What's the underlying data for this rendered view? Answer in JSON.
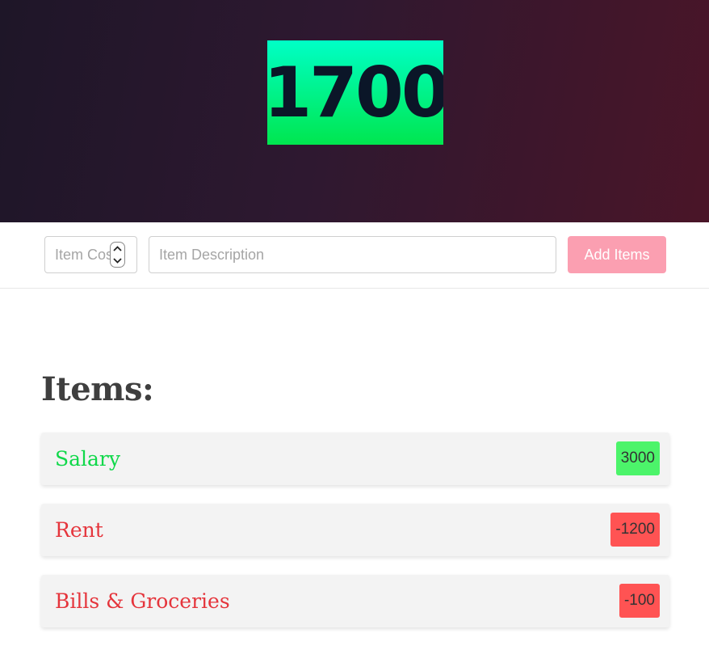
{
  "header": {
    "balance": "1700",
    "colors": {
      "background_start": "#1e1628",
      "background_end": "#4a1528",
      "balance_start": "#00ffc6",
      "balance_end": "#00e64f",
      "balance_text": "#0b1628"
    }
  },
  "form": {
    "cost_placeholder": "Item Cost",
    "description_placeholder": "Item Description",
    "add_label": "Add Items",
    "add_color": "#fb9fb1"
  },
  "items": {
    "heading": "Items:",
    "list": [
      {
        "description": "Salary",
        "amount": "3000",
        "type": "income"
      },
      {
        "description": "Rent",
        "amount": "-1200",
        "type": "expense"
      },
      {
        "description": "Bills & Groceries",
        "amount": "-100",
        "type": "expense"
      }
    ],
    "colors": {
      "income_text": "#10d84a",
      "income_badge": "#4cf46a",
      "expense_text": "#e5353c",
      "expense_badge": "#ff5353"
    }
  }
}
